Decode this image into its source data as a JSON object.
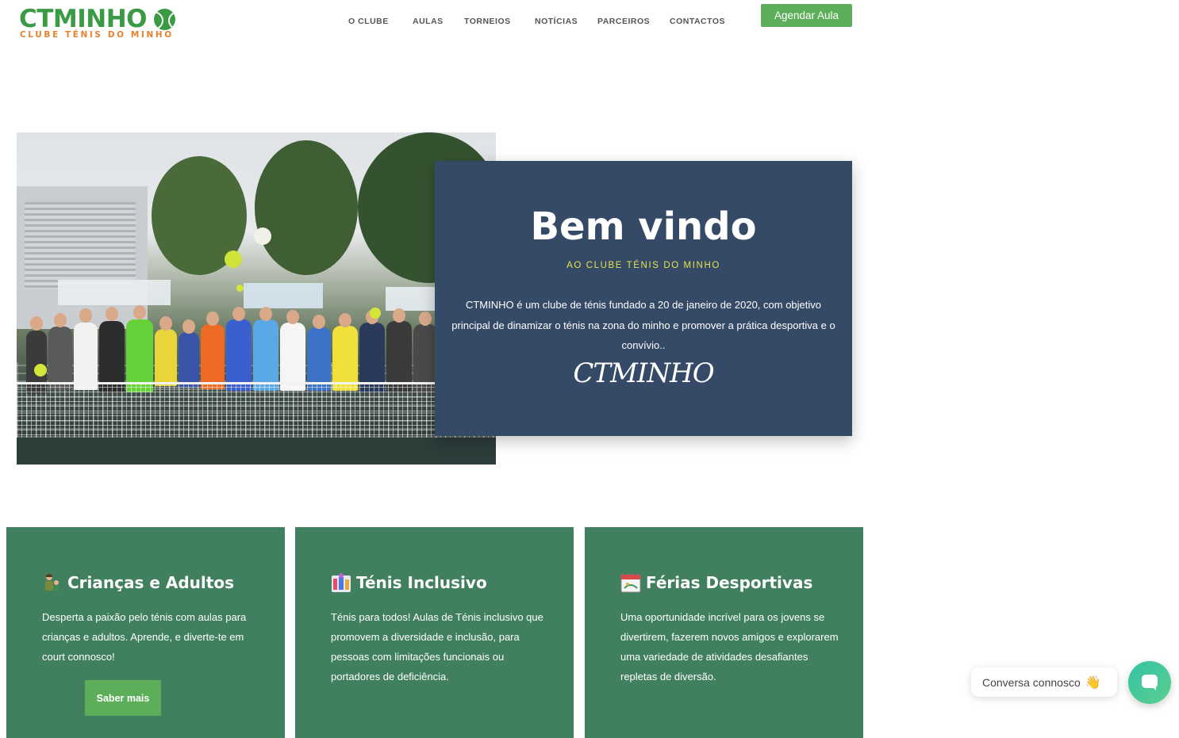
{
  "header": {
    "logo_text": "CTMINHO",
    "logo_subtitle": "CLUBE TÉNIS DO MINHO",
    "nav": [
      "O CLUBE",
      "AULAS",
      "TORNEIOS",
      "NOTÍCIAS",
      "PARCEIROS",
      "CONTACTOS"
    ],
    "cta_label": "Agendar Aula"
  },
  "hero": {
    "photo_icon": "group-photo-tennis-players",
    "title": "Bem vindo",
    "subtitle": "AO CLUBE TÉNIS DO MINHO",
    "body": "CTMINHO é um clube de ténis fundado a 20 de janeiro de 2020, com objetivo principal de dinamizar o ténis na zona do minho e promover a prática desportiva e o convívio..",
    "signature": "CTMINHO"
  },
  "cards": [
    {
      "icon": "family-icon",
      "title": "Crianças e Adultos",
      "text": "Desperta a paixão pelo ténis com aulas para crianças e adultos. Aprende, e diverte-te em court connosco!",
      "button": "Saber mais"
    },
    {
      "icon": "inclusive-icon",
      "title": "Ténis Inclusivo",
      "text": "Ténis para todos! Aulas de Ténis inclusivo que promovem a diversidade e inclusão, para pessoas com limitações funcionais ou portadores de deficiência."
    },
    {
      "icon": "calendar-icon",
      "title": "Férias Desportivas",
      "text": "Uma oportunidade incrível para os jovens se divertirem, fazerem novos amigos e explorarem uma variedade de atividades desafiantes repletas de diversão."
    }
  ],
  "chat": {
    "bubble_text": "Conversa connosco",
    "wave": "👋",
    "button_icon": "chat-icon"
  },
  "colors": {
    "brand_green": "#3a9b44",
    "brand_orange": "#e8822e",
    "card_green": "#41805f",
    "hero_navy": "#344a67",
    "accent_yellow": "#e3e34a"
  }
}
